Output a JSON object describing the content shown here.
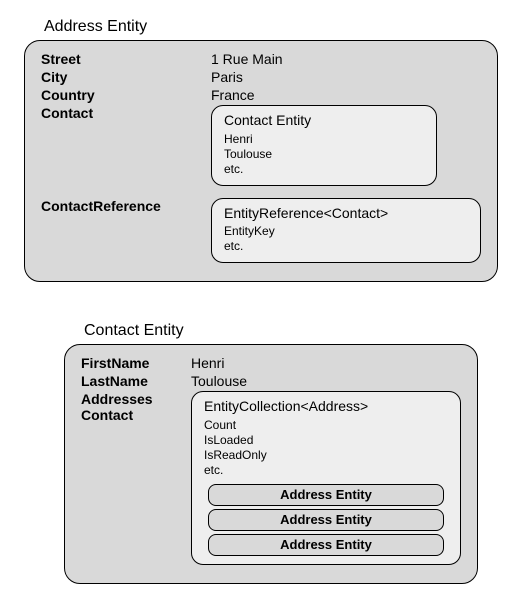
{
  "address_entity": {
    "title": "Address Entity",
    "fields": {
      "street_label": "Street",
      "street_value": "1 Rue Main",
      "city_label": "City",
      "city_value": "Paris",
      "country_label": "Country",
      "country_value": "France",
      "contact_label": "Contact",
      "contact_ref_label": "ContactReference"
    },
    "contact_box": {
      "title": "Contact Entity",
      "lines": [
        "Henri",
        "Toulouse",
        "etc."
      ]
    },
    "contact_ref_box": {
      "title": "EntityReference<Contact>",
      "lines": [
        "EntityKey",
        "etc."
      ]
    }
  },
  "contact_entity": {
    "title": "Contact Entity",
    "fields": {
      "firstname_label": "FirstName",
      "firstname_value": "Henri",
      "lastname_label": "LastName",
      "lastname_value": "Toulouse",
      "addresses_label": "Addresses",
      "contact_label": "Contact"
    },
    "collection_box": {
      "title": "EntityCollection<Address>",
      "lines": [
        "Count",
        "IsLoaded",
        "IsReadOnly",
        "etc."
      ],
      "nested_items": [
        "Address Entity",
        "Address Entity",
        "Address Entity"
      ]
    }
  }
}
